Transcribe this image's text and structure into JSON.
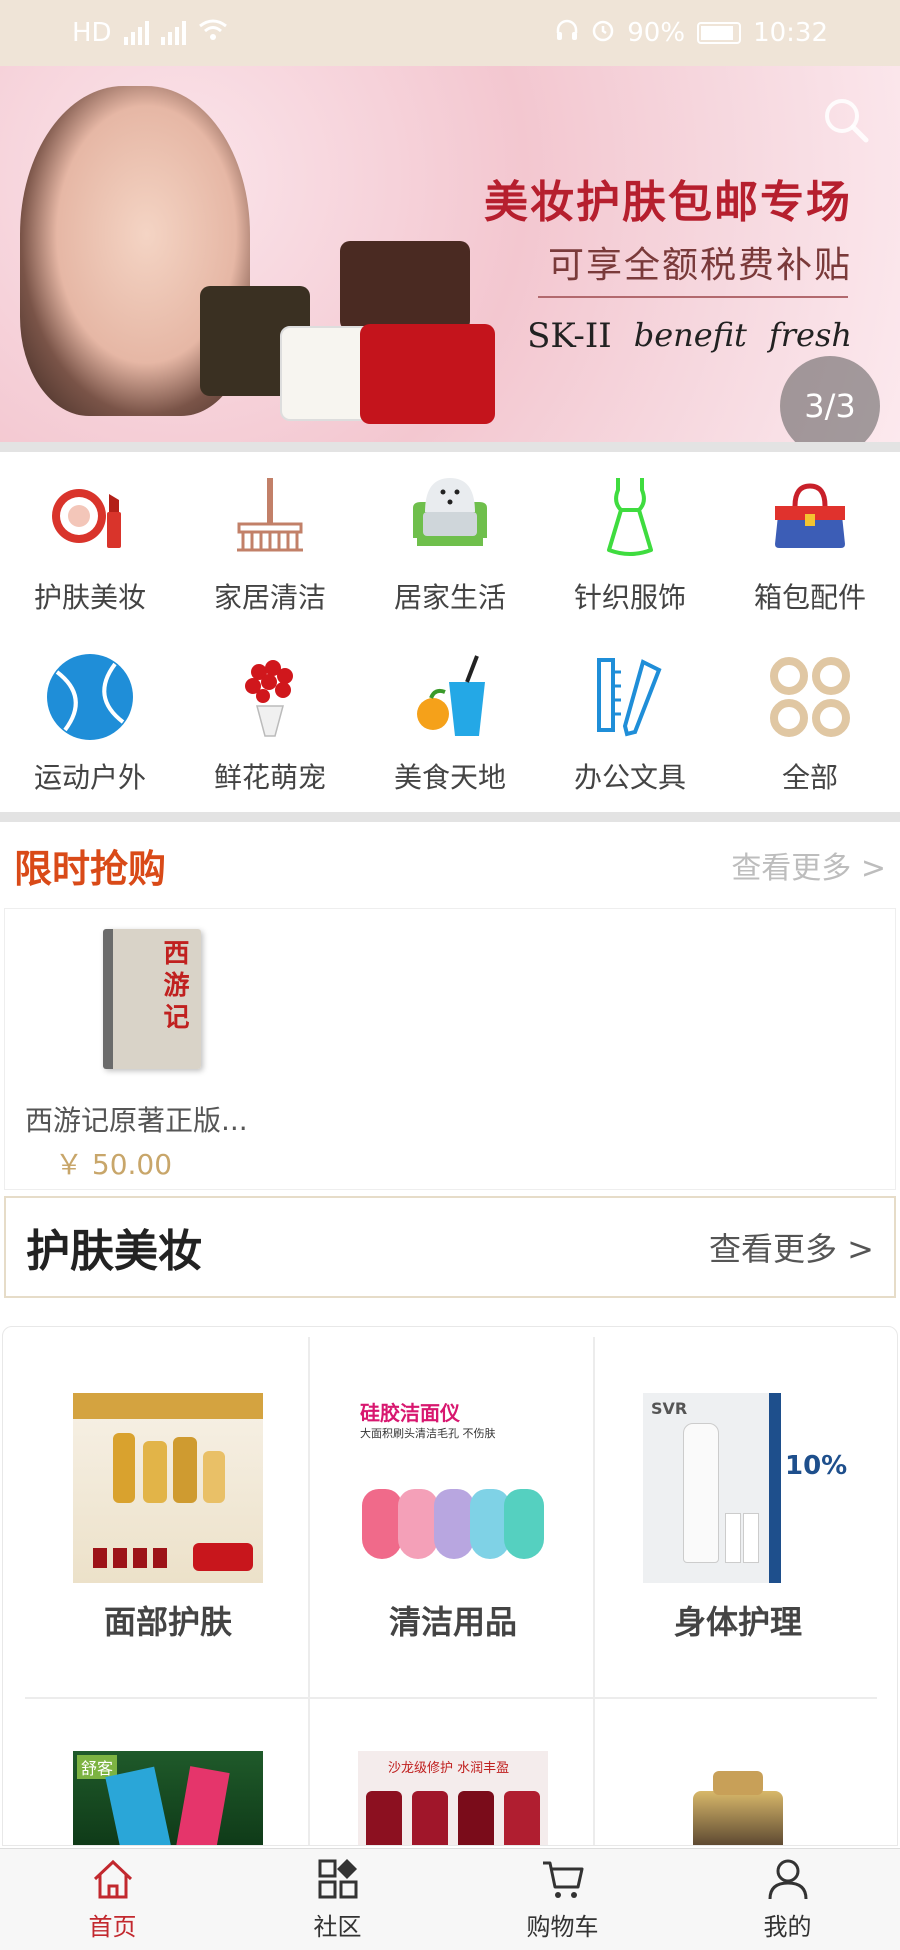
{
  "status_bar": {
    "network": "HD",
    "battery": "90%",
    "time": "10:32"
  },
  "banner": {
    "title": "美妆护肤包邮专场",
    "subtitle": "可享全额税费补贴",
    "brands": [
      "SK-II",
      "benefit",
      "fresh"
    ],
    "page_indicator": "3/3"
  },
  "categories": [
    {
      "label": "护肤美妆",
      "icon": "compact-lipstick-icon"
    },
    {
      "label": "家居清洁",
      "icon": "broom-icon"
    },
    {
      "label": "居家生活",
      "icon": "armchair-icon"
    },
    {
      "label": "针织服饰",
      "icon": "dress-icon"
    },
    {
      "label": "箱包配件",
      "icon": "handbag-icon"
    },
    {
      "label": "运动户外",
      "icon": "tennis-ball-icon"
    },
    {
      "label": "鲜花萌宠",
      "icon": "flower-bouquet-icon"
    },
    {
      "label": "美食天地",
      "icon": "drink-fruit-icon"
    },
    {
      "label": "办公文具",
      "icon": "pen-ruler-icon"
    },
    {
      "label": "全部",
      "icon": "four-rings-icon"
    }
  ],
  "flash_sale": {
    "title": "限时抢购",
    "more": "查看更多 >",
    "product": {
      "name": "西游记原著正版...",
      "price": "￥ 50.00",
      "cover_title": "西游记"
    }
  },
  "section": {
    "title": "护肤美妆",
    "more": "查看更多 >",
    "items": [
      {
        "name": "面部护肤"
      },
      {
        "name": "清洁用品",
        "img_title": "硅胶洁面仪",
        "img_sub": "大面积刷头清洁毛孔 不伤肤"
      },
      {
        "name": "身体护理",
        "img_badge": "10%",
        "img_brand": "SVR"
      }
    ],
    "partial_items": [
      {
        "img_text": "舒客"
      },
      {
        "img_text": "沙龙级修护 水润丰盈"
      },
      {
        "img_text": ""
      }
    ]
  },
  "bottom_nav": [
    {
      "label": "首页",
      "icon": "home-icon",
      "active": true
    },
    {
      "label": "社区",
      "icon": "grid-icon",
      "active": false
    },
    {
      "label": "购物车",
      "icon": "cart-icon",
      "active": false
    },
    {
      "label": "我的",
      "icon": "user-icon",
      "active": false
    }
  ],
  "colors": {
    "accent": "#c2282e",
    "flash_title": "#d94a18",
    "price": "#c8a66a",
    "status_bar": "#efe4d7"
  }
}
